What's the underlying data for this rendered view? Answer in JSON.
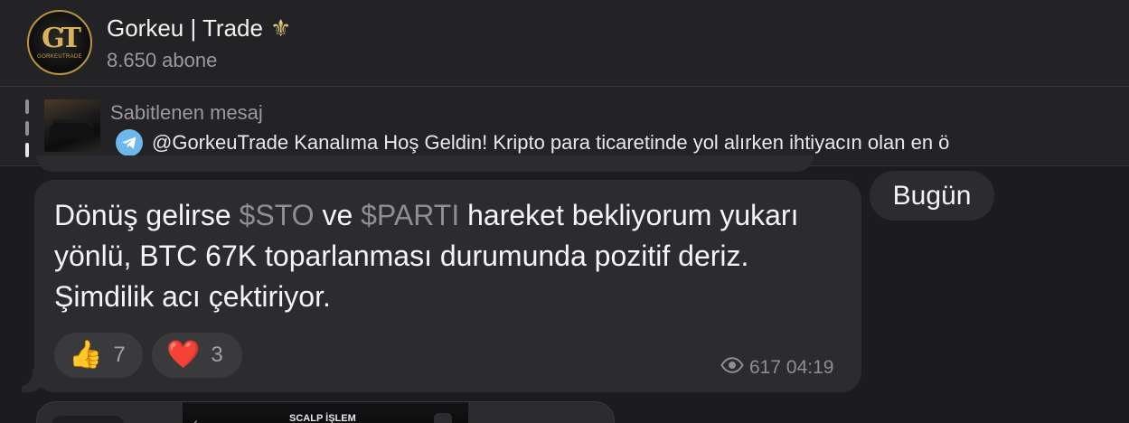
{
  "header": {
    "channel_name": "Gorkeu | Trade",
    "title_emoji": "⚜",
    "subscribers": "8.650 abone",
    "avatar": {
      "monogram": "GT",
      "caption": "GORKEUTRADE"
    }
  },
  "pinned": {
    "label": "Sabitlenen mesaj",
    "text": "@GorkeuTrade Kanalıma Hoş Geldin!   Kripto para ticaretinde yol alırken ihtiyacın olan en ö"
  },
  "date_separator": "Bugün",
  "message": {
    "parts": {
      "p1": "Dönüş gelirse ",
      "tag1": "$STO",
      "p2": " ve ",
      "tag2": "$PARTI",
      "p3": " hareket bekliyorum yukarı yönlü, BTC 67K toparlanması durumunda pozitif deriz. Şimdilik acı çektiriyor."
    },
    "reactions": [
      {
        "emoji": "👍",
        "count": "7"
      },
      {
        "emoji": "❤️",
        "count": "3"
      }
    ],
    "views": "617",
    "time": "04:19"
  },
  "next_message": {
    "image_caption": "SCALP İŞLEM"
  },
  "colors": {
    "background": "#1c1c1e",
    "bubble": "#2c2c2e",
    "muted_text": "#8e8e93",
    "accent_gold": "#c9a24e",
    "telegram_blue": "#6cb8ea"
  }
}
